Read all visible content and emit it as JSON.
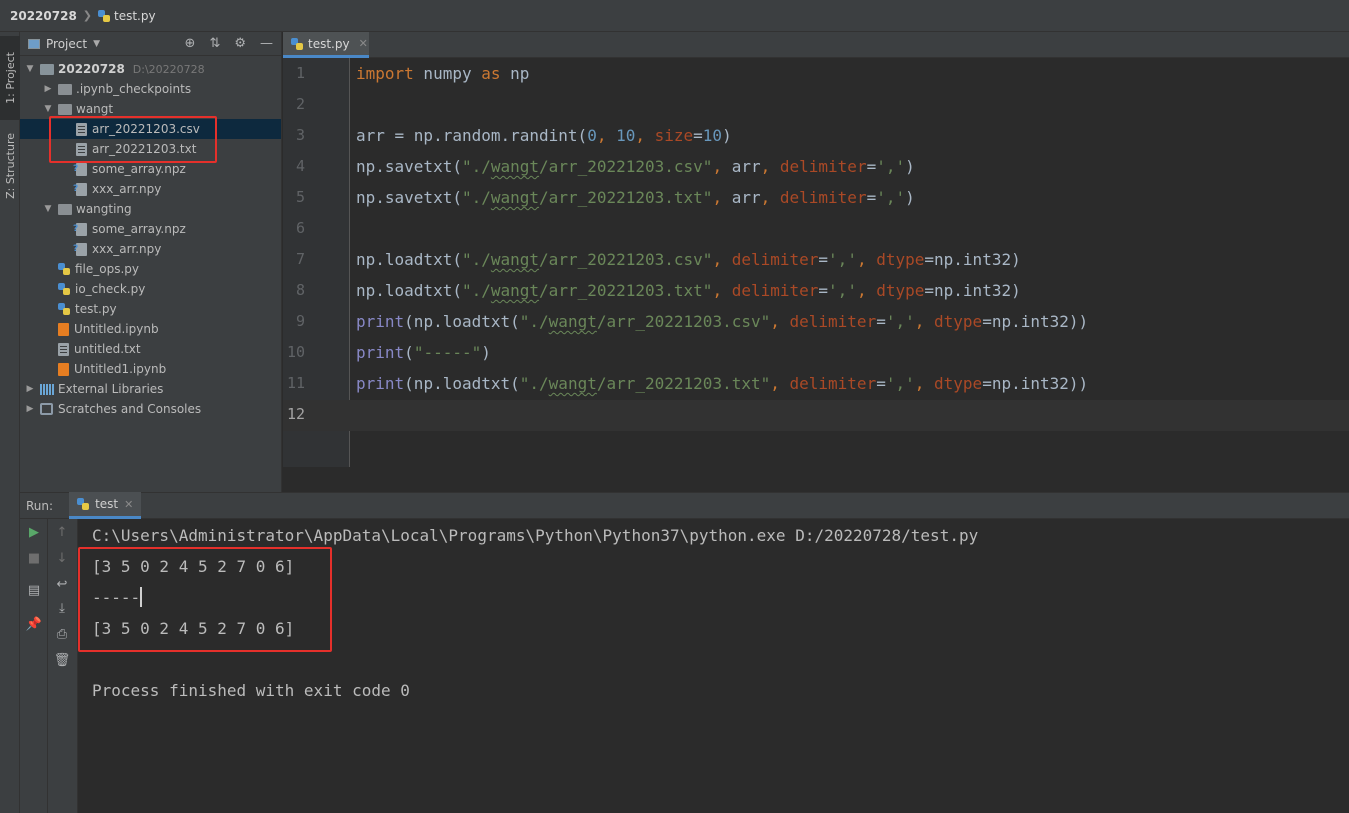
{
  "titlebar": {
    "project": "20220728",
    "file": "test.py"
  },
  "left_strip": {
    "project_tab": "1: Project",
    "structure_tab": "Z: Structure"
  },
  "project_panel": {
    "title": "Project",
    "tree": [
      {
        "label": "20220728",
        "path": "D:\\20220728",
        "kind": "root-folder",
        "expanded": true
      },
      {
        "label": ".ipynb_checkpoints",
        "kind": "folder",
        "expanded": false
      },
      {
        "label": "wangt",
        "kind": "folder",
        "expanded": true
      },
      {
        "label": "arr_20221203.csv",
        "kind": "text-file",
        "selected": true
      },
      {
        "label": "arr_20221203.txt",
        "kind": "text-file"
      },
      {
        "label": "some_array.npz",
        "kind": "unknown-file"
      },
      {
        "label": "xxx_arr.npy",
        "kind": "unknown-file"
      },
      {
        "label": "wangting",
        "kind": "folder",
        "expanded": true
      },
      {
        "label": "some_array.npz",
        "kind": "unknown-file"
      },
      {
        "label": "xxx_arr.npy",
        "kind": "unknown-file"
      },
      {
        "label": "file_ops.py",
        "kind": "python-file"
      },
      {
        "label": "io_check.py",
        "kind": "python-file"
      },
      {
        "label": "test.py",
        "kind": "python-file"
      },
      {
        "label": "Untitled.ipynb",
        "kind": "notebook-file"
      },
      {
        "label": "untitled.txt",
        "kind": "text-file"
      },
      {
        "label": "Untitled1.ipynb",
        "kind": "notebook-file"
      },
      {
        "label": "External Libraries",
        "kind": "libraries",
        "expanded": false
      },
      {
        "label": "Scratches and Consoles",
        "kind": "scratches",
        "expanded": false
      }
    ]
  },
  "editor": {
    "tab_label": "test.py",
    "line_numbers": [
      "1",
      "2",
      "3",
      "4",
      "5",
      "6",
      "7",
      "8",
      "9",
      "10",
      "11",
      "12"
    ],
    "current_line": "12",
    "colors": {
      "keyword": "#cc7832",
      "string": "#6a8759",
      "number": "#6897bb",
      "parameter": "#aa4926",
      "builtin": "#8888c6",
      "text": "#a9b7c6"
    },
    "lines": [
      [
        {
          "t": "import",
          "c": "kw"
        },
        {
          "t": " numpy "
        },
        {
          "t": "as",
          "c": "kw"
        },
        {
          "t": " np"
        }
      ],
      [],
      [
        {
          "t": "arr = np.random.randint("
        },
        {
          "t": "0",
          "c": "num"
        },
        {
          "t": ", ",
          "c": "kw"
        },
        {
          "t": "10",
          "c": "num"
        },
        {
          "t": ", ",
          "c": "kw"
        },
        {
          "t": "size",
          "c": "param"
        },
        {
          "t": "="
        },
        {
          "t": "10",
          "c": "num"
        },
        {
          "t": ")"
        }
      ],
      [
        {
          "t": "np.savetxt("
        },
        {
          "t": "\"./",
          "c": "str"
        },
        {
          "t": "wangt",
          "c": "str ul"
        },
        {
          "t": "/arr_20221203.csv\"",
          "c": "str"
        },
        {
          "t": ", ",
          "c": "kw"
        },
        {
          "t": "arr"
        },
        {
          "t": ", ",
          "c": "kw"
        },
        {
          "t": "delimiter",
          "c": "param"
        },
        {
          "t": "="
        },
        {
          "t": "','",
          "c": "str"
        },
        {
          "t": ")"
        }
      ],
      [
        {
          "t": "np.savetxt("
        },
        {
          "t": "\"./",
          "c": "str"
        },
        {
          "t": "wangt",
          "c": "str ul"
        },
        {
          "t": "/arr_20221203.txt\"",
          "c": "str"
        },
        {
          "t": ", ",
          "c": "kw"
        },
        {
          "t": "arr"
        },
        {
          "t": ", ",
          "c": "kw"
        },
        {
          "t": "delimiter",
          "c": "param"
        },
        {
          "t": "="
        },
        {
          "t": "','",
          "c": "str"
        },
        {
          "t": ")"
        }
      ],
      [],
      [
        {
          "t": "np.loadtxt("
        },
        {
          "t": "\"./",
          "c": "str"
        },
        {
          "t": "wangt",
          "c": "str ul"
        },
        {
          "t": "/arr_20221203.csv\"",
          "c": "str"
        },
        {
          "t": ", ",
          "c": "kw"
        },
        {
          "t": "delimiter",
          "c": "param"
        },
        {
          "t": "="
        },
        {
          "t": "','",
          "c": "str"
        },
        {
          "t": ", ",
          "c": "kw"
        },
        {
          "t": "dtype",
          "c": "param"
        },
        {
          "t": "=np.int32)"
        }
      ],
      [
        {
          "t": "np.loadtxt("
        },
        {
          "t": "\"./",
          "c": "str"
        },
        {
          "t": "wangt",
          "c": "str ul"
        },
        {
          "t": "/arr_20221203.txt\"",
          "c": "str"
        },
        {
          "t": ", ",
          "c": "kw"
        },
        {
          "t": "delimiter",
          "c": "param"
        },
        {
          "t": "="
        },
        {
          "t": "','",
          "c": "str"
        },
        {
          "t": ", ",
          "c": "kw"
        },
        {
          "t": "dtype",
          "c": "param"
        },
        {
          "t": "=np.int32)"
        }
      ],
      [
        {
          "t": "print",
          "c": "bi"
        },
        {
          "t": "(np.loadtxt("
        },
        {
          "t": "\"./",
          "c": "str"
        },
        {
          "t": "wangt",
          "c": "str ul"
        },
        {
          "t": "/arr_20221203.csv\"",
          "c": "str"
        },
        {
          "t": ", ",
          "c": "kw"
        },
        {
          "t": "delimiter",
          "c": "param"
        },
        {
          "t": "="
        },
        {
          "t": "','",
          "c": "str"
        },
        {
          "t": ", ",
          "c": "kw"
        },
        {
          "t": "dtype",
          "c": "param"
        },
        {
          "t": "=np.int32))"
        }
      ],
      [
        {
          "t": "print",
          "c": "bi"
        },
        {
          "t": "("
        },
        {
          "t": "\"-----\"",
          "c": "str"
        },
        {
          "t": ")"
        }
      ],
      [
        {
          "t": "print",
          "c": "bi"
        },
        {
          "t": "(np.loadtxt("
        },
        {
          "t": "\"./",
          "c": "str"
        },
        {
          "t": "wangt",
          "c": "str ul"
        },
        {
          "t": "/arr_20221203.txt\"",
          "c": "str"
        },
        {
          "t": ", ",
          "c": "kw"
        },
        {
          "t": "delimiter",
          "c": "param"
        },
        {
          "t": "="
        },
        {
          "t": "','",
          "c": "str"
        },
        {
          "t": ", ",
          "c": "kw"
        },
        {
          "t": "dtype",
          "c": "param"
        },
        {
          "t": "=np.int32))"
        }
      ],
      []
    ]
  },
  "run_panel": {
    "label": "Run:",
    "tab_label": "test",
    "output": [
      "C:\\Users\\Administrator\\AppData\\Local\\Programs\\Python\\Python37\\python.exe D:/20220728/test.py",
      "[3 5 0 2 4 5 2 7 0 6]",
      "-----",
      "[3 5 0 2 4 5 2 7 0 6]",
      "",
      "Process finished with exit code 0"
    ]
  },
  "annotation_color": "#e5302b"
}
